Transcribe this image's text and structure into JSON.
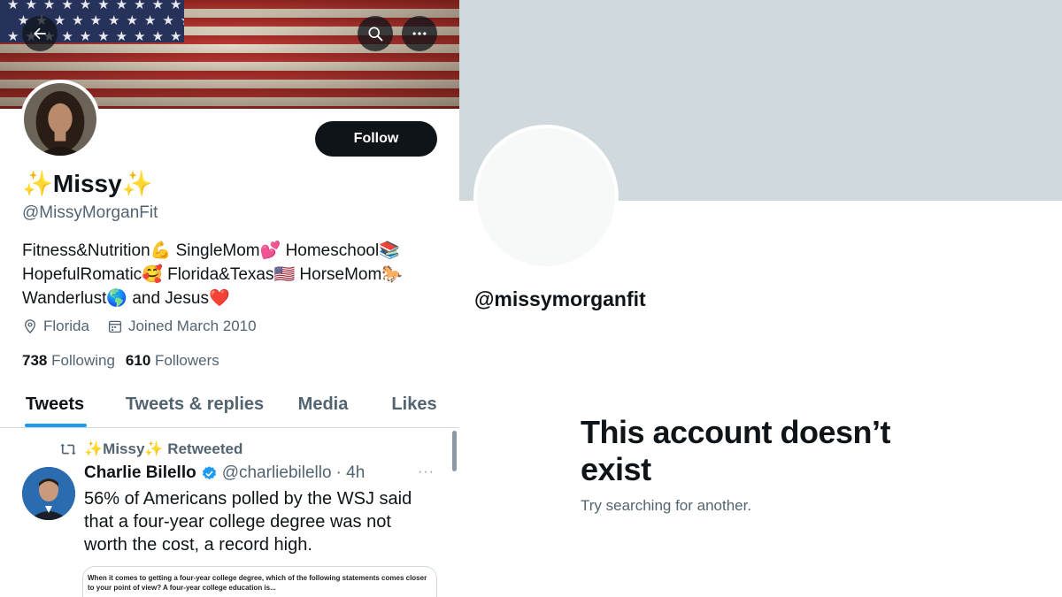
{
  "left_profile": {
    "back_icon": "arrow-left-icon",
    "search_icon": "search-icon",
    "more_icon": "more-horizontal-icon",
    "follow_label": "Follow",
    "display_name": "✨Missy✨",
    "handle": "@MissyMorganFit",
    "bio": "Fitness&Nutrition💪 SingleMom💕 Homeschool📚\nHopefulRomatic🥰 Florida&Texas🇺🇸 HorseMom🐎\nWanderlust🌎 and Jesus❤️",
    "location": "Florida",
    "joined": "Joined March 2010",
    "following_count": "738",
    "following_label": "Following",
    "followers_count": "610",
    "followers_label": "Followers",
    "tabs": [
      {
        "label": "Tweets",
        "active": true
      },
      {
        "label": "Tweets & replies",
        "active": false
      },
      {
        "label": "Media",
        "active": false
      },
      {
        "label": "Likes",
        "active": false
      }
    ],
    "tweet": {
      "retweeted_by": "✨Missy✨ Retweeted",
      "author_name": "Charlie Bilello",
      "author_handle": "@charliebilello",
      "time": "· 4h",
      "more": "···",
      "text": "56% of Americans polled by the WSJ said that a four-year college degree was not worth the cost, a record high.",
      "card_text": "When it comes to getting a four-year college degree, which of the following statements comes closer to your point of view? A four-year college education is..."
    }
  },
  "right_profile": {
    "handle": "@missymorganfit",
    "title": "This account doesn’t exist",
    "subtitle": "Try searching for another."
  },
  "colors": {
    "accent": "#1d9bf0",
    "text_primary": "#0f1419",
    "text_secondary": "#536471",
    "banner_placeholder": "#cfd9de"
  }
}
